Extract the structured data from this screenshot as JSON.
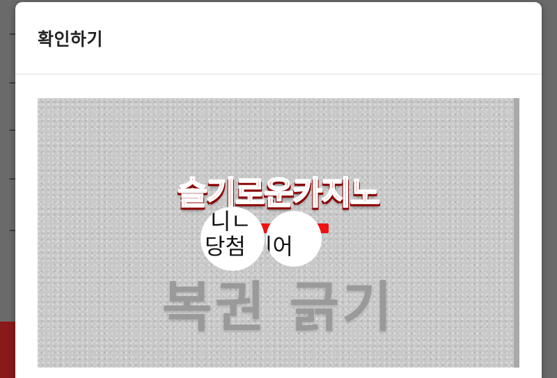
{
  "dialog": {
    "title": "확인하기"
  },
  "scratch_card": {
    "brand_logo": "슬기로운카지노",
    "main_text": "복권 긁기",
    "revealed": {
      "line1": "니ㄴ",
      "line2_left": "당첨",
      "line2_right": "되어"
    }
  },
  "colors": {
    "overlay": "#5f5f5f",
    "dialog_bg": "#ffffff",
    "card_surface": "#c8c8c8",
    "brand_red": "#ff2222",
    "scratch_text": "#9a9a9a"
  }
}
